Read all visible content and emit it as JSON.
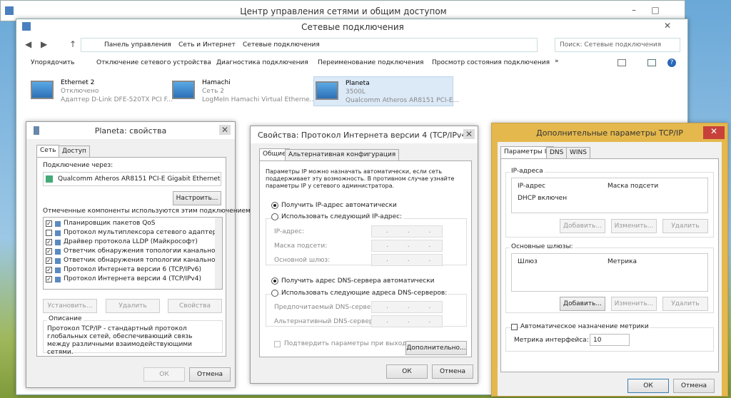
{
  "back_window": {
    "title": "Центр управления сетями и общим доступом"
  },
  "main_window": {
    "title": "Сетевые подключения"
  },
  "breadcrumb": {
    "p1": "Панель управления",
    "p2": "Сеть и Интернет",
    "p3": "Сетевые подключения"
  },
  "search": {
    "placeholder": "Поиск: Сетевые подключения"
  },
  "toolbar": {
    "organize": "Упорядочить",
    "disconnect": "Отключение сетевого устройства",
    "diagnose": "Диагностика подключения",
    "rename": "Переименование подключения",
    "status": "Просмотр состояния подключения",
    "more": "»"
  },
  "connections": [
    {
      "name": "Ethernet 2",
      "status": "Отключено",
      "device": "Адаптер D-Link DFE-520TX PCI F..."
    },
    {
      "name": "Hamachi",
      "status": "Сеть  2",
      "device": "LogMeIn Hamachi Virtual Etherne..."
    },
    {
      "name": "Planeta",
      "status": "3500L",
      "device": "Qualcomm Atheros AR8151 PCI-E..."
    }
  ],
  "props": {
    "title": "Planeta: свойства",
    "tab_net": "Сеть",
    "tab_access": "Доступ",
    "connect_via": "Подключение через:",
    "adapter": "Qualcomm Atheros AR8151 PCI-E Gigabit Ethernet Contro",
    "configure": "Настроить...",
    "components_label": "Отмеченные компоненты используются этим подключением:",
    "components": [
      {
        "label": "Планировщик пакетов QoS",
        "checked": true
      },
      {
        "label": "Протокол мультиплексора сетевого адаптера (Май",
        "checked": false
      },
      {
        "label": "Драйвер протокола LLDP (Майкрософт)",
        "checked": true
      },
      {
        "label": "Ответчик обнаружения топологии канального уров",
        "checked": true
      },
      {
        "label": "Ответчик обнаружения топологии канального уров",
        "checked": true
      },
      {
        "label": "Протокол Интернета версии 6 (TCP/IPv6)",
        "checked": true
      },
      {
        "label": "Протокол Интернета версии 4 (TCP/IPv4)",
        "checked": true
      }
    ],
    "install": "Установить...",
    "remove": "Удалить",
    "properties": "Свойства",
    "desc_title": "Описание",
    "desc_text": "Протокол TCP/IP - стандартный протокол глобальных сетей, обеспечивающий связь между различными взаимодействующими сетями.",
    "ok": "ОК",
    "cancel": "Отмена"
  },
  "ipv4": {
    "title": "Свойства: Протокол Интернета версии 4 (TCP/IPv4)",
    "tab_general": "Общие",
    "tab_alt": "Альтернативная конфигурация",
    "intro": "Параметры IP можно назначать автоматически, если сеть поддерживает эту возможность. В противном случае узнайте параметры IP у сетевого администратора.",
    "auto_ip": "Получить IP-адрес автоматически",
    "manual_ip": "Использовать следующий IP-адрес:",
    "ip_addr": "IP-адрес:",
    "mask": "Маска подсети:",
    "gateway": "Основной шлюз:",
    "auto_dns": "Получить адрес DNS-сервера автоматически",
    "manual_dns": "Использовать следующие адреса DNS-серверов:",
    "pref_dns": "Предпочитаемый DNS-сервер:",
    "alt_dns": "Альтернативный DNS-сервер:",
    "validate": "Подтвердить параметры при выходе",
    "advanced": "Дополнительно...",
    "ok": "ОК",
    "cancel": "Отмена",
    "dots": ". . ."
  },
  "adv": {
    "title": "Дополнительные параметры TCP/IP",
    "tab_ip": "Параметры IP",
    "tab_dns": "DNS",
    "tab_wins": "WINS",
    "ip_group": "IP-адреса",
    "col_ip": "IP-адрес",
    "col_mask": "Маска подсети",
    "dhcp": "DHCP включен",
    "add": "Добавить...",
    "edit": "Изменить...",
    "remove": "Удалить",
    "gw_group": "Основные шлюзы:",
    "col_gw": "Шлюз",
    "col_metric": "Метрика",
    "add2": "Добавить...",
    "edit2": "Изменить...",
    "remove2": "Удалить",
    "auto_metric": "Автоматическое назначение метрики",
    "iface_metric": "Метрика интерфейса:",
    "metric_value": "10",
    "ok": "ОК",
    "cancel": "Отмена"
  }
}
